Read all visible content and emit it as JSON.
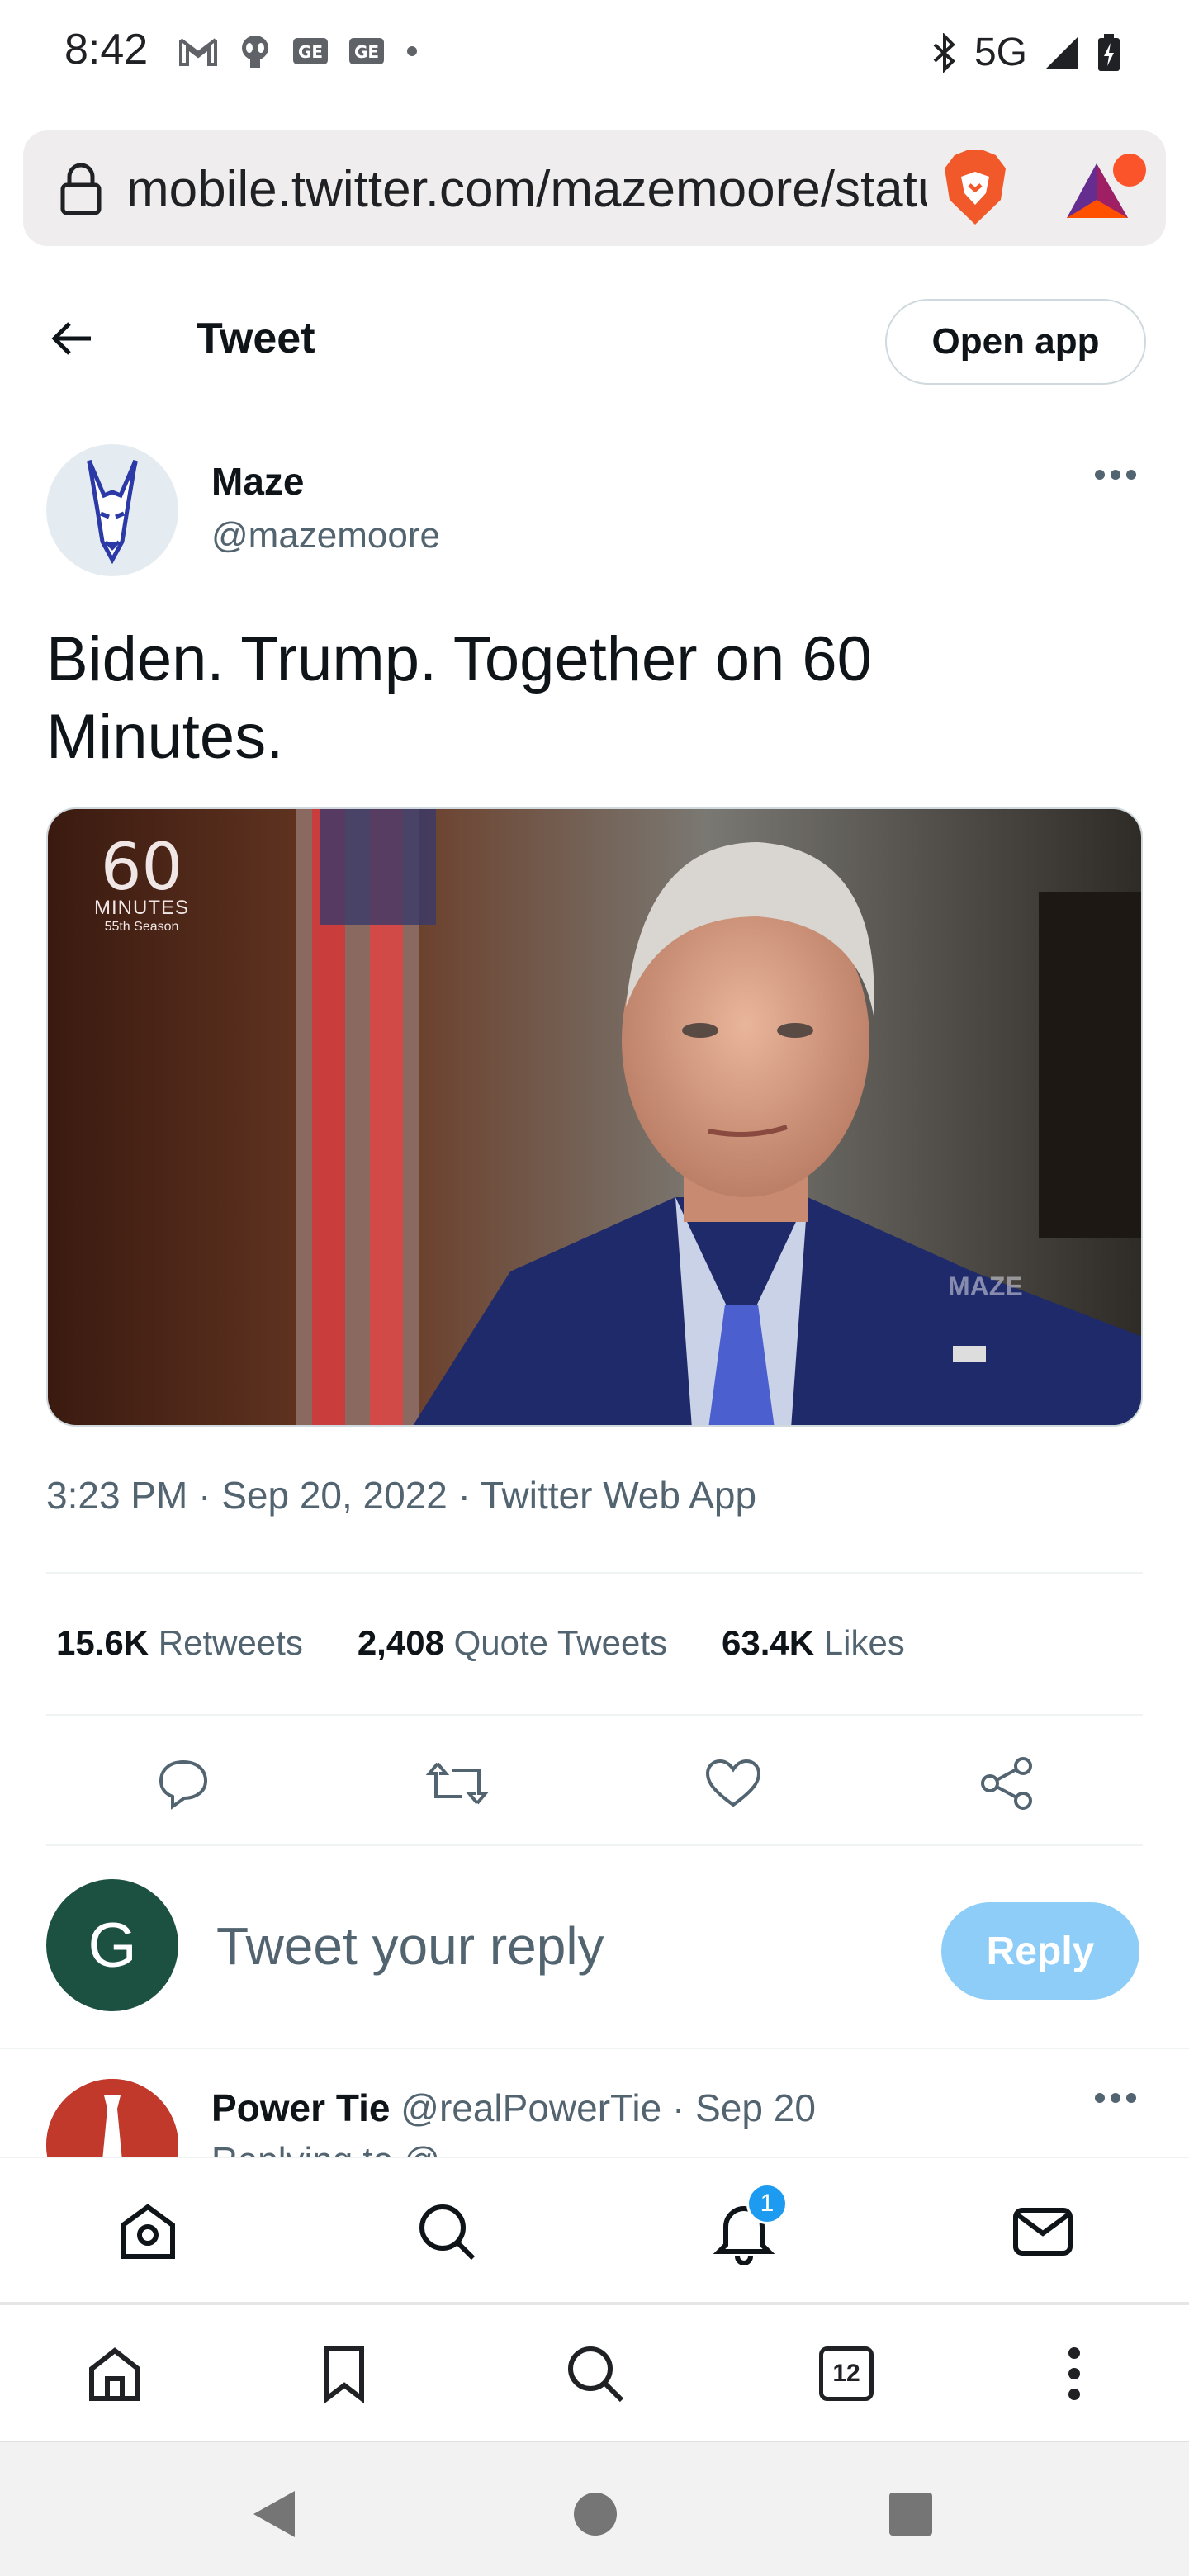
{
  "status_bar": {
    "time": "8:42",
    "network": "5G",
    "left_icons": [
      "gmail-icon",
      "alien-icon",
      "ge-icon",
      "ge-icon",
      "dot-icon"
    ],
    "right_icons": [
      "bluetooth-icon",
      "signal-icon",
      "battery-charging-icon"
    ]
  },
  "browser": {
    "url": "mobile.twitter.com/mazemoore/status",
    "tabs_count": "12"
  },
  "header": {
    "title": "Tweet",
    "open_app_label": "Open app"
  },
  "tweet": {
    "author_name": "Maze",
    "author_handle": "@mazemoore",
    "text": "Biden. Trump. Together on 60 Minutes.",
    "media": {
      "logo_number": "60",
      "logo_word": "MINUTES",
      "logo_season": "55th Season",
      "watermark": "MAZE"
    },
    "time": "3:23 PM",
    "date": "Sep 20, 2022",
    "source": "Twitter Web App",
    "retweets_count": "15.6K",
    "retweets_label": "Retweets",
    "quotes_count": "2,408",
    "quotes_label": "Quote Tweets",
    "likes_count": "63.4K",
    "likes_label": "Likes"
  },
  "reply_box": {
    "avatar_letter": "G",
    "placeholder": "Tweet your reply",
    "button_label": "Reply"
  },
  "next_reply": {
    "name": "Power Tie",
    "handle": "@realPowerTie",
    "date": "Sep 20",
    "sub_text": "Replying to @..."
  },
  "bottom_nav": {
    "notification_badge": "1"
  },
  "colors": {
    "twitter_blue": "#1d9bf0",
    "reply_button_disabled": "#8ecdf8",
    "reply_avatar_bg": "#1c5142",
    "secondary_text": "#536471"
  }
}
